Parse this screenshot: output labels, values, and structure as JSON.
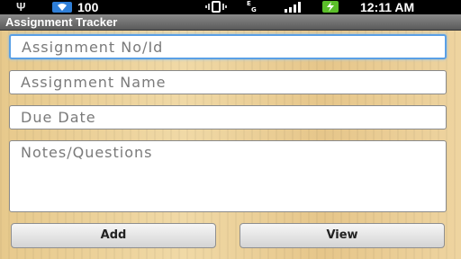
{
  "status_bar": {
    "battery_pct": "100",
    "time": "12:11 AM",
    "data_indicator": "E\n3G",
    "icons": [
      "usb-icon",
      "wifi-icon",
      "vibrate-icon",
      "data-icon",
      "signal-icon",
      "charging-icon"
    ]
  },
  "app": {
    "title": "Assignment Tracker"
  },
  "form": {
    "assignment_id_placeholder": "Assignment No/Id",
    "assignment_name_placeholder": "Assignment Name",
    "due_date_placeholder": "Due Date",
    "notes_placeholder": "Notes/Questions"
  },
  "buttons": {
    "add_label": "Add",
    "view_label": "View"
  },
  "colors": {
    "focus_border": "#5aa0e6",
    "wifi_badge": "#2f7fd8",
    "charge_badge": "#5bbf2a"
  }
}
